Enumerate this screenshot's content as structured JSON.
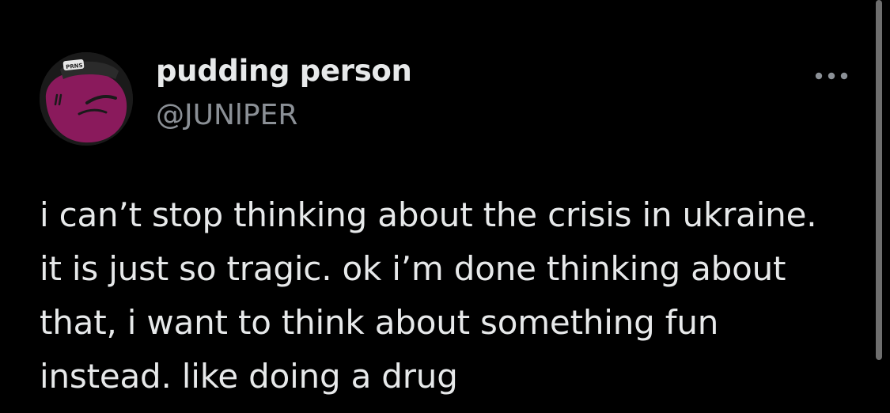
{
  "author": {
    "display_name": "pudding person",
    "handle": "@JUNlPER",
    "avatar_hat_text": "PRNS"
  },
  "tweet": {
    "text": "i can’t stop thinking about the crisis in ukraine.\nit is just so tragic.  ok i’m done thinking about\nthat, i want to think about something fun\ninstead.  like doing a drug"
  },
  "icons": {
    "more": "more-horizontal-icon"
  },
  "colors": {
    "background": "#000000",
    "primary_text": "#e7e9ea",
    "secondary_text": "#8b9096",
    "avatar_purple": "#8a1a5c"
  }
}
